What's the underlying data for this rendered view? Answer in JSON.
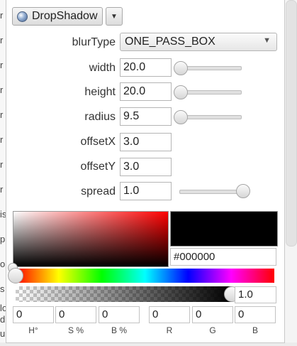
{
  "background": {
    "letters": [
      "r",
      "r",
      "r",
      "r",
      "r",
      "r",
      "r",
      "r",
      "is",
      "p",
      "o",
      "s",
      "lo",
      "d",
      "u"
    ]
  },
  "effect": {
    "name": "DropShadow",
    "icon": "globe-icon",
    "menu_icon": "chevron-down-icon"
  },
  "properties": {
    "blurType": {
      "label": "blurType",
      "value": "ONE_PASS_BOX"
    },
    "width": {
      "label": "width",
      "value": "20.0",
      "slider_fraction": 0.0
    },
    "height": {
      "label": "height",
      "value": "20.0",
      "slider_fraction": 0.0
    },
    "radius": {
      "label": "radius",
      "value": "9.5",
      "slider_fraction": 0.0
    },
    "offsetX": {
      "label": "offsetX",
      "value": "3.0"
    },
    "offsetY": {
      "label": "offsetY",
      "value": "3.0"
    },
    "spread": {
      "label": "spread",
      "value": "1.0",
      "slider_fraction": 1.0
    }
  },
  "color_picker": {
    "hex": "#000000",
    "alpha": "1.0",
    "hue_fraction": 0.0,
    "alpha_fraction": 1.0,
    "fields": [
      {
        "value": "0",
        "label": "H°"
      },
      {
        "value": "0",
        "label": "S %"
      },
      {
        "value": "0",
        "label": "B %"
      },
      {
        "value": "0",
        "label": "R"
      },
      {
        "value": "0",
        "label": "G"
      },
      {
        "value": "0",
        "label": "B"
      }
    ]
  },
  "colors": {
    "selected": "#000000",
    "saturation_base": "#ff0000"
  }
}
